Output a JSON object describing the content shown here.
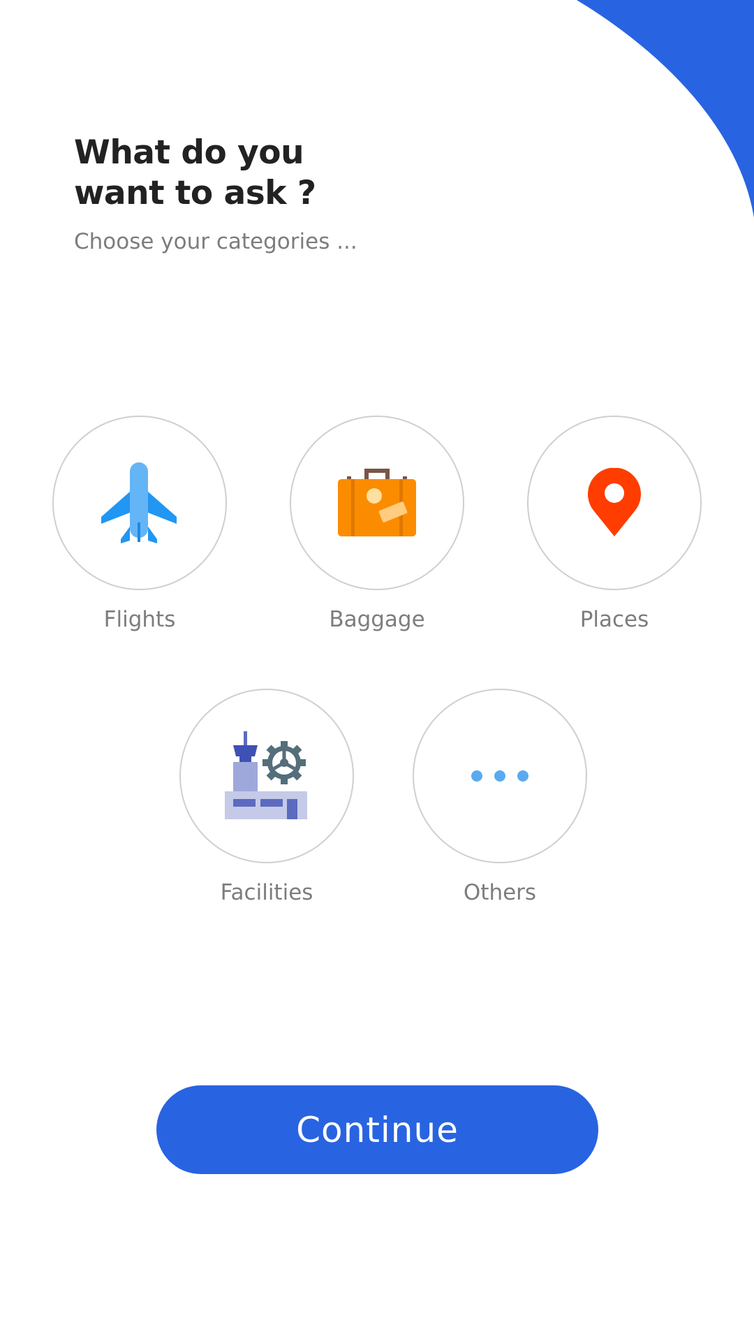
{
  "header": {
    "title_line1": "What do you",
    "title_line2": "want to ask ?",
    "subtitle": "Choose your categories ..."
  },
  "categories": [
    {
      "label": "Flights",
      "icon": "airplane-icon"
    },
    {
      "label": "Baggage",
      "icon": "suitcase-icon"
    },
    {
      "label": "Places",
      "icon": "map-pin-icon"
    },
    {
      "label": "Facilities",
      "icon": "airport-tower-icon"
    },
    {
      "label": "Others",
      "icon": "more-dots-icon"
    }
  ],
  "actions": {
    "continue_label": "Continue"
  },
  "colors": {
    "accent": "#2864e1",
    "title": "#222222",
    "muted": "#7d7d7d",
    "circle_border": "#cfcfcf",
    "flight_blue": "#42a5f5",
    "baggage_orange": "#fb8c00",
    "pin_red": "#ff3d00",
    "facility_purple": "#5c6bc0",
    "dots_blue": "#64b5f6"
  }
}
